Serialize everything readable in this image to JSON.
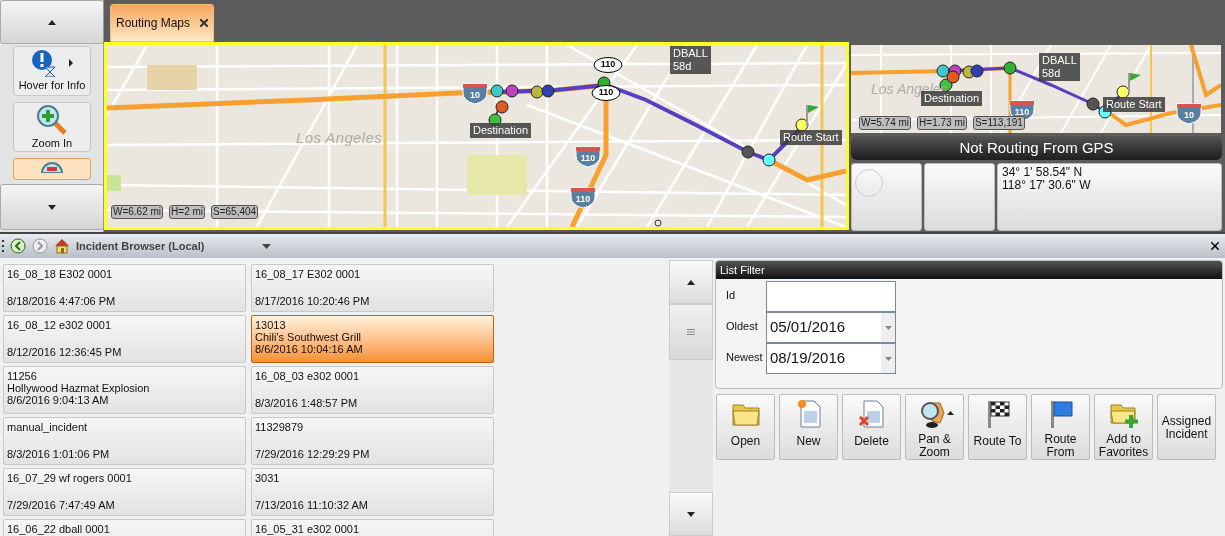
{
  "side_toolbar": {
    "tools": [
      {
        "kind": "info",
        "label": "Hover for Info",
        "selected": false,
        "submenu": true
      },
      {
        "kind": "zoom_in",
        "label": "Zoom In",
        "selected": false
      },
      {
        "kind": "zoom_out",
        "selected": true
      }
    ]
  },
  "tabs": [
    {
      "label": "Routing Maps",
      "selected": true
    }
  ],
  "main_map": {
    "city_label": "Los Angeles",
    "shields": [
      {
        "kind": "interstate",
        "label": "10"
      },
      {
        "kind": "state",
        "label": "110"
      },
      {
        "kind": "state",
        "label": "110"
      },
      {
        "kind": "interstate",
        "label": "110"
      },
      {
        "kind": "interstate",
        "label": "110"
      }
    ],
    "callouts": [
      {
        "kind": "unit",
        "lines": [
          "DBALL",
          "58d"
        ]
      },
      {
        "kind": "destination",
        "lines": [
          "Destination"
        ]
      },
      {
        "kind": "start",
        "lines": [
          "Route Start"
        ]
      }
    ],
    "scale": [
      "W=6.62 mi",
      "H=2 mi",
      "S=65,404"
    ]
  },
  "mini_map": {
    "city_label": "Los Angeles",
    "shields": [
      {
        "kind": "interstate",
        "label": "110"
      },
      {
        "kind": "interstate",
        "label": "10"
      }
    ],
    "callouts": [
      {
        "kind": "unit",
        "lines": [
          "DBALL",
          "58d"
        ]
      },
      {
        "kind": "destination",
        "lines": [
          "Destination"
        ]
      },
      {
        "kind": "start",
        "lines": [
          "Route Start"
        ]
      }
    ],
    "scale": [
      "W=5.74 mi",
      "H=1.73 mi",
      "S=113,191"
    ]
  },
  "gps_status": "Not Routing From GPS",
  "position": [
    "34° 1' 58.54\" N",
    "118° 17' 30.6\" W"
  ],
  "browser": {
    "title": "Incident Browser (Local)",
    "incidents": [
      {
        "id": "16_08_18 E302 0001",
        "time": "8/18/2016 4:47:06 PM",
        "selected": false
      },
      {
        "id": "16_08_17 E302 0001",
        "time": "8/17/2016 10:20:46 PM",
        "selected": false
      },
      {
        "id": "16_08_12 e302 0001",
        "time": "8/12/2016 12:36:45 PM",
        "selected": false
      },
      {
        "id": "13013",
        "name": "Chili's Southwest Grill",
        "time": "8/6/2016 10:04:16 AM",
        "selected": true
      },
      {
        "id": "11256",
        "name": "Hollywood Hazmat Explosion",
        "time": "8/6/2016 9:04:13 AM",
        "selected": false
      },
      {
        "id": "16_08_03 e302 0001",
        "time": "8/3/2016 1:48:57 PM",
        "selected": false
      },
      {
        "id": "manual_incident",
        "time": "8/3/2016 1:01:06 PM",
        "selected": false
      },
      {
        "id": "11329879",
        "time": "7/29/2016 12:29:29 PM",
        "selected": false
      },
      {
        "id": "16_07_29 wf rogers 0001",
        "time": "7/29/2016 7:47:49 AM",
        "selected": false
      },
      {
        "id": "3031",
        "time": "7/13/2016 11:10:32 AM",
        "selected": false
      },
      {
        "id": "16_06_22 dball 0001",
        "selected": false
      },
      {
        "id": "16_05_31 e302 0001",
        "selected": false
      }
    ],
    "filter": {
      "title": "List Filter",
      "fields": [
        {
          "kind": "text",
          "label": "Id"
        },
        {
          "kind": "date",
          "label": "Oldest",
          "value": "05/01/2016"
        },
        {
          "kind": "date",
          "label": "Newest",
          "value": "08/19/2016"
        }
      ]
    },
    "actions": [
      {
        "kind": "open",
        "label": "Open"
      },
      {
        "kind": "new",
        "label": "New"
      },
      {
        "kind": "delete",
        "label": "Delete"
      },
      {
        "kind": "pan_zoom",
        "label": "Pan & Zoom"
      },
      {
        "kind": "route_to",
        "label": "Route To"
      },
      {
        "kind": "route_from",
        "label": "Route From"
      },
      {
        "kind": "favorite",
        "label": "Add to Favorites"
      },
      {
        "kind": "text",
        "label": "Assigned Incident"
      }
    ]
  }
}
